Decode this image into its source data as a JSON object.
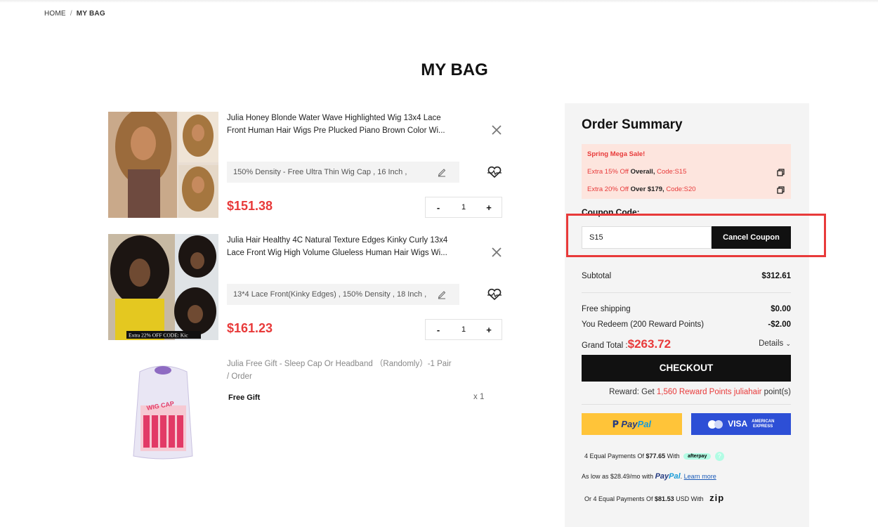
{
  "breadcrumb": {
    "home": "HOME",
    "separator": "/",
    "current": "MY BAG"
  },
  "page_title": "MY BAG",
  "cart_items": [
    {
      "title": "Julia Honey Blonde Water Wave Highlighted Wig 13x4 Lace Front Human Hair Wigs Pre Plucked Piano Brown Color Wi...",
      "variant": "150% Density - Free Ultra Thin Wig Cap , 16 Inch ,",
      "price": "$151.38",
      "qty_minus": "-",
      "quantity": "1",
      "qty_plus": "+"
    },
    {
      "title": "Julia Hair Healthy 4C Natural Texture Edges Kinky Curly 13x4 Lace Front Wig High Volume Glueless Human Hair Wigs Wi...",
      "variant": "13*4 Lace Front(Kinky Edges) , 150% Density , 18 Inch ,",
      "price": "$161.23",
      "image_caption": "Extra 22% OFF  CODE: Kic",
      "qty_minus": "-",
      "quantity": "1",
      "qty_plus": "+"
    }
  ],
  "gift_item": {
    "title": "Julia Free Gift - Sleep Cap Or Headband （Randomly）-1 Pair / Order",
    "label": "Free Gift",
    "quantity": "x 1",
    "package_text": "WIG CAP"
  },
  "summary": {
    "title": "Order Summary",
    "promo": {
      "headline": "Spring Mega Sale!",
      "line1_prefix": "Extra 15% Off",
      "line1_mid": " Overall, ",
      "line1_code": "Code:S15",
      "line2_prefix": "Extra 20% Off",
      "line2_mid": " Over $179, ",
      "line2_code": "Code:S20"
    },
    "coupon_label": "Coupon Code:",
    "coupon_value": "S15",
    "cancel_coupon": "Cancel Coupon",
    "subtotal_label": "Subtotal",
    "subtotal_value": "$312.61",
    "shipping_label": "Free shipping",
    "shipping_value": "$0.00",
    "redeem_label": "You Redeem (200 Reward Points)",
    "redeem_value": "-$2.00",
    "grand_label": "Grand Total :",
    "grand_value": "$263.72",
    "details": "Details",
    "checkout": "CHECKOUT",
    "reward_prefix": "Reward: Get ",
    "reward_points": "1,560 Reward Points",
    "reward_brand": " juliahair",
    "reward_suffix": " point(s)",
    "paypal_pay": "Pay",
    "paypal_pal": "Pal",
    "card_button": "VISA",
    "amex_text": "AMERICAN EXPRESS",
    "afterpay_prefix": "4 Equal Payments Of ",
    "afterpay_amount": "$77.65",
    "afterpay_with": " With",
    "afterpay_logo": "afterpay",
    "afterpay_help": "?",
    "paypal_line_prefix": "As low as $28.49/mo with ",
    "learn_more": "Learn more",
    "zip_prefix": "Or 4 Equal Payments Of ",
    "zip_amount": "$81.53",
    "zip_suffix": " USD With",
    "zip_logo": "zip"
  },
  "colors": {
    "accent_red": "#e83a3a",
    "paypal_yellow": "#ffc439",
    "card_blue": "#2d4fd6",
    "promo_bg": "#fde5de"
  }
}
